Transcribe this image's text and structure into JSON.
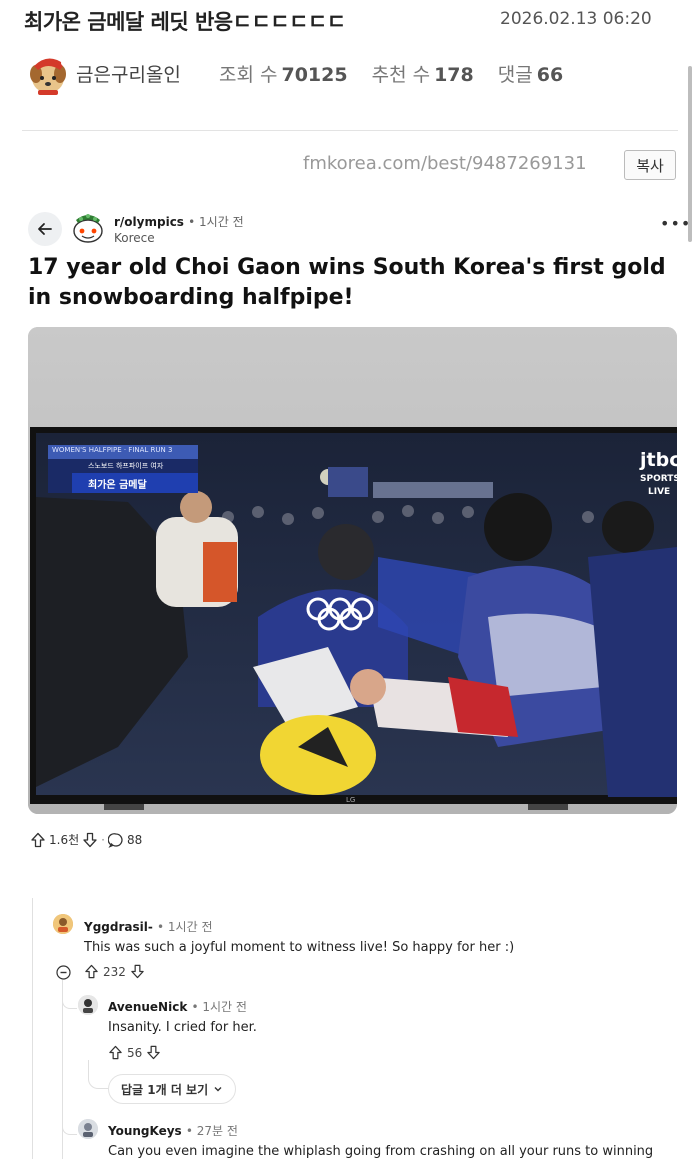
{
  "header": {
    "title": "최가온 금메달 레딧 반응ㄷㄷㄷㄷㄷㄷ",
    "date": "2026.02.13 06:20",
    "author": "금은구리올인",
    "views_label": "조회 수",
    "views": "70125",
    "recommend_label": "추천 수",
    "recommend": "178",
    "comments_label": "댓글",
    "comments": "66"
  },
  "source": {
    "url": "fmkorea.com/best/9487269131",
    "copy_label": "복사"
  },
  "post": {
    "subreddit": "r/olympics",
    "time": "• 1시간 전",
    "flair": "Korece",
    "title": "17 year old Choi Gaon wins South Korea's first gold in snowboarding halfpipe!",
    "upvotes": "1.6천",
    "comments": "88"
  },
  "photo": {
    "overlay_top": "WOMEN'S HALFPIPE · FINAL RUN 3",
    "overlay_sub": "스노보드 하프파이프 여자",
    "overlay_main": "최가온 금메달",
    "broadcaster": "jtbc",
    "broadcaster_sub": "SPORTS",
    "live": "LIVE",
    "tv_brand": "LG"
  },
  "comments": [
    {
      "user": "Yggdrasil-",
      "time": "• 1시간 전",
      "text": "This was such a joyful moment to witness live! So happy for her :)",
      "votes": "232"
    },
    {
      "user": "AvenueNick",
      "time": "• 1시간 전",
      "text": "Insanity. I cried for her.",
      "votes": "56"
    },
    {
      "user": "YoungKeys",
      "time": "• 27분 전",
      "text": "Can you even imagine the whiplash going from crashing on all your runs to winning"
    }
  ],
  "more_replies_label": "답글 1개 더 보기",
  "colors": {
    "accent": "#ff4500",
    "text": "#222222",
    "muted": "#777777"
  }
}
